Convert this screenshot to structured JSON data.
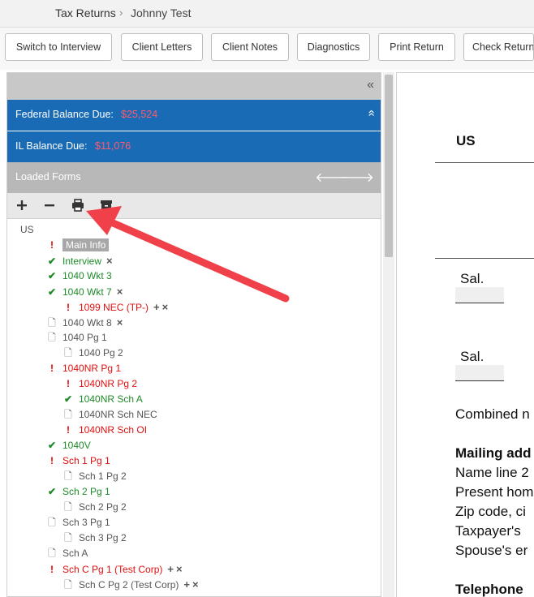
{
  "breadcrumb": {
    "root": "Tax Returns",
    "separator": "›",
    "current": "Johnny Test"
  },
  "toolbar": {
    "switch_interview": "Switch to Interview",
    "client_letters": "Client Letters",
    "client_notes": "Client Notes",
    "diagnostics": "Diagnostics",
    "print_return": "Print Return",
    "check_return": "Check Return"
  },
  "panel": {
    "collapse_icon": "«",
    "federal": {
      "label": "Federal  Balance Due:",
      "value": "$25,524",
      "icon": "»"
    },
    "il": {
      "label": "IL  Balance Due:",
      "value": "$11,076"
    },
    "loaded_forms": {
      "title": "Loaded Forms",
      "prev": "🡐",
      "next": "🡒"
    },
    "actions": {
      "add": "add-icon",
      "remove": "remove-icon",
      "print": "print-icon",
      "archive": "archive-icon"
    }
  },
  "tree": {
    "root": "US",
    "items": [
      {
        "label": "Main Info",
        "status": "error",
        "selected": true
      },
      {
        "label": "Interview",
        "status": "ok",
        "remove": "×"
      },
      {
        "label": "1040 Wkt 3",
        "status": "ok"
      },
      {
        "label": "1040 Wkt 7",
        "status": "ok",
        "remove": "×"
      },
      {
        "label": "1099 NEC (TP-)",
        "status": "error",
        "add": "+",
        "remove": "×"
      },
      {
        "label": "1040 Wkt 8",
        "status": "doc",
        "remove": "×"
      },
      {
        "label": "1040 Pg 1",
        "status": "doc"
      },
      {
        "label": "1040 Pg 2",
        "status": "doc"
      },
      {
        "label": "1040NR Pg 1",
        "status": "error"
      },
      {
        "label": "1040NR Pg 2",
        "status": "error"
      },
      {
        "label": "1040NR Sch A",
        "status": "ok"
      },
      {
        "label": "1040NR Sch NEC",
        "status": "doc"
      },
      {
        "label": "1040NR Sch OI",
        "status": "error"
      },
      {
        "label": "1040V",
        "status": "ok"
      },
      {
        "label": "Sch 1 Pg 1",
        "status": "error"
      },
      {
        "label": "Sch 1 Pg 2",
        "status": "doc"
      },
      {
        "label": "Sch 2 Pg 1",
        "status": "ok"
      },
      {
        "label": "Sch 2 Pg 2",
        "status": "doc"
      },
      {
        "label": "Sch 3 Pg 1",
        "status": "doc"
      },
      {
        "label": "Sch 3 Pg 2",
        "status": "doc"
      },
      {
        "label": "Sch A",
        "status": "doc"
      },
      {
        "label": "Sch C Pg 1 (Test Corp)",
        "status": "error",
        "add": "+",
        "remove": "×"
      },
      {
        "label": "Sch C Pg 2 (Test Corp)",
        "status": "doc",
        "add": "+",
        "remove": "×"
      }
    ]
  },
  "form_preview": {
    "country": "US",
    "sal_1": "Sal.",
    "sal_2": "Sal.",
    "combined": "Combined n",
    "mailing_heading": "Mailing add",
    "lines": [
      "Name line 2",
      "Present hom",
      "Zip code, ci",
      "Taxpayer's",
      "Spouse's er"
    ],
    "telephone_heading": "Telephone"
  },
  "colors": {
    "accent_blue": "#1a6bb5",
    "balance_red": "#ff5a6e",
    "error_red": "#e00000",
    "ok_green": "#1f8a2a",
    "arrow_red": "#f0414a"
  }
}
